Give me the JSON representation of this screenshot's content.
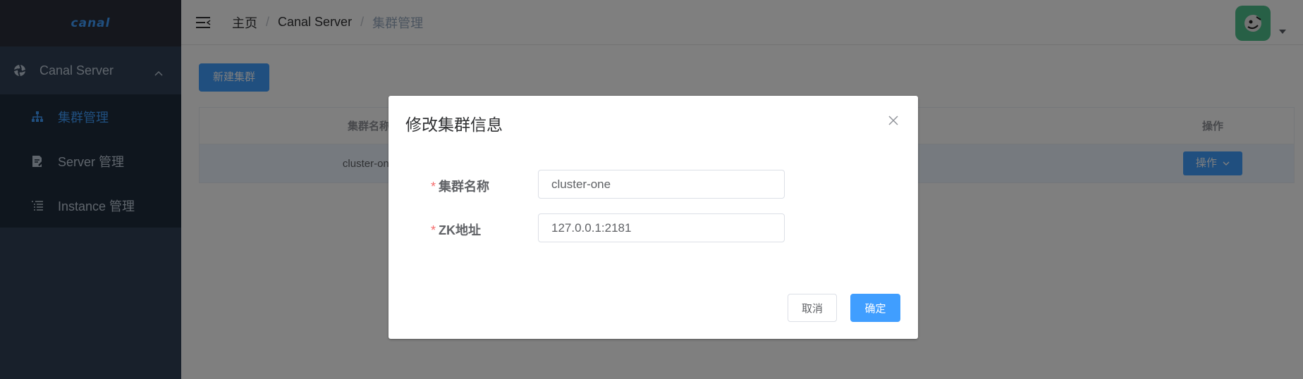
{
  "app": {
    "logo_text": "canal"
  },
  "sidebar": {
    "group": {
      "label": "Canal Server",
      "icon": "aperture-icon",
      "expanded": true
    },
    "items": [
      {
        "label": "集群管理",
        "icon": "cluster-icon",
        "active": true
      },
      {
        "label": "Server 管理",
        "icon": "edit-document-icon",
        "active": false
      },
      {
        "label": "Instance 管理",
        "icon": "list-icon",
        "active": false
      }
    ]
  },
  "navbar": {
    "breadcrumb": [
      "主页",
      "Canal Server",
      "集群管理"
    ],
    "separator": "/"
  },
  "main": {
    "new_button_label": "新建集群",
    "table": {
      "columns": [
        "集群名称",
        "操作"
      ],
      "rows": [
        {
          "name": "cluster-one",
          "action_label": "操作"
        }
      ]
    }
  },
  "dialog": {
    "title": "修改集群信息",
    "fields": [
      {
        "label": "集群名称",
        "required": true,
        "value": "cluster-one"
      },
      {
        "label": "ZK地址",
        "required": true,
        "value": "127.0.0.1:2181"
      }
    ],
    "cancel_label": "取消",
    "confirm_label": "确定"
  },
  "colors": {
    "primary": "#409eff",
    "sidebar_bg": "#304156",
    "submenu_bg": "#1f2d3d",
    "required_star": "#f56c6c"
  }
}
